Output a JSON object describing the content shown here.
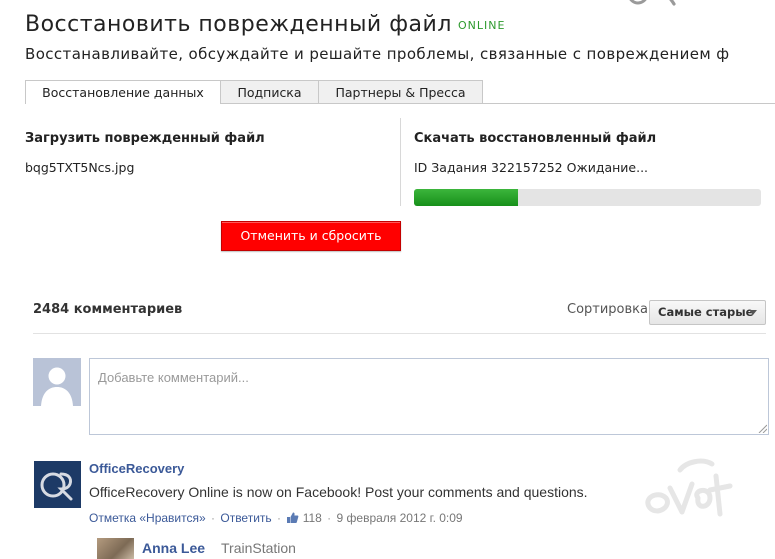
{
  "header": {
    "title": "Восстановить поврежденный файл",
    "status_badge": "ONLINE",
    "subtitle": "Восстанавливайте, обсуждайте и решайте проблемы, связанные с повреждением ф"
  },
  "tabs": [
    {
      "label": "Восстановление данных",
      "active": true
    },
    {
      "label": "Подписка",
      "active": false
    },
    {
      "label": "Партнеры & Пресса",
      "active": false
    }
  ],
  "upload": {
    "title": "Загрузить поврежденный файл",
    "file_name": "bqg5TXT5Ncs.jpg",
    "reset_button": "Отменить и сбросить"
  },
  "download": {
    "title": "Скачать восстановленный файл",
    "task_status": "ID Задания 322157252 Ожидание...",
    "progress_fraction": 0.3
  },
  "comments": {
    "count_label": "2484 комментариев",
    "sort_label": "Сортировка",
    "sort_selected": "Самые старые",
    "input_placeholder": "Добавьте комментарий...",
    "items": [
      {
        "author": "OfficeRecovery",
        "text": "OfficeRecovery Online is now on Facebook! Post your comments and questions.",
        "like_link": "Отметка «Нравится»",
        "reply_link": "Ответить",
        "likes": "118",
        "date": "9 февраля 2012 г. 0:09"
      }
    ],
    "reply": {
      "author": "Anna Lee",
      "location": "TrainStation"
    }
  },
  "colors": {
    "accent_red": "#ff0000",
    "progress_green": "#22a022",
    "online_green": "#2e9a2e",
    "link_blue": "#3b5998"
  },
  "icons": [
    "office-recovery-logo-icon",
    "default-avatar-icon",
    "like-thumb-icon",
    "sort-caret-icon",
    "textarea-resize-icon"
  ]
}
